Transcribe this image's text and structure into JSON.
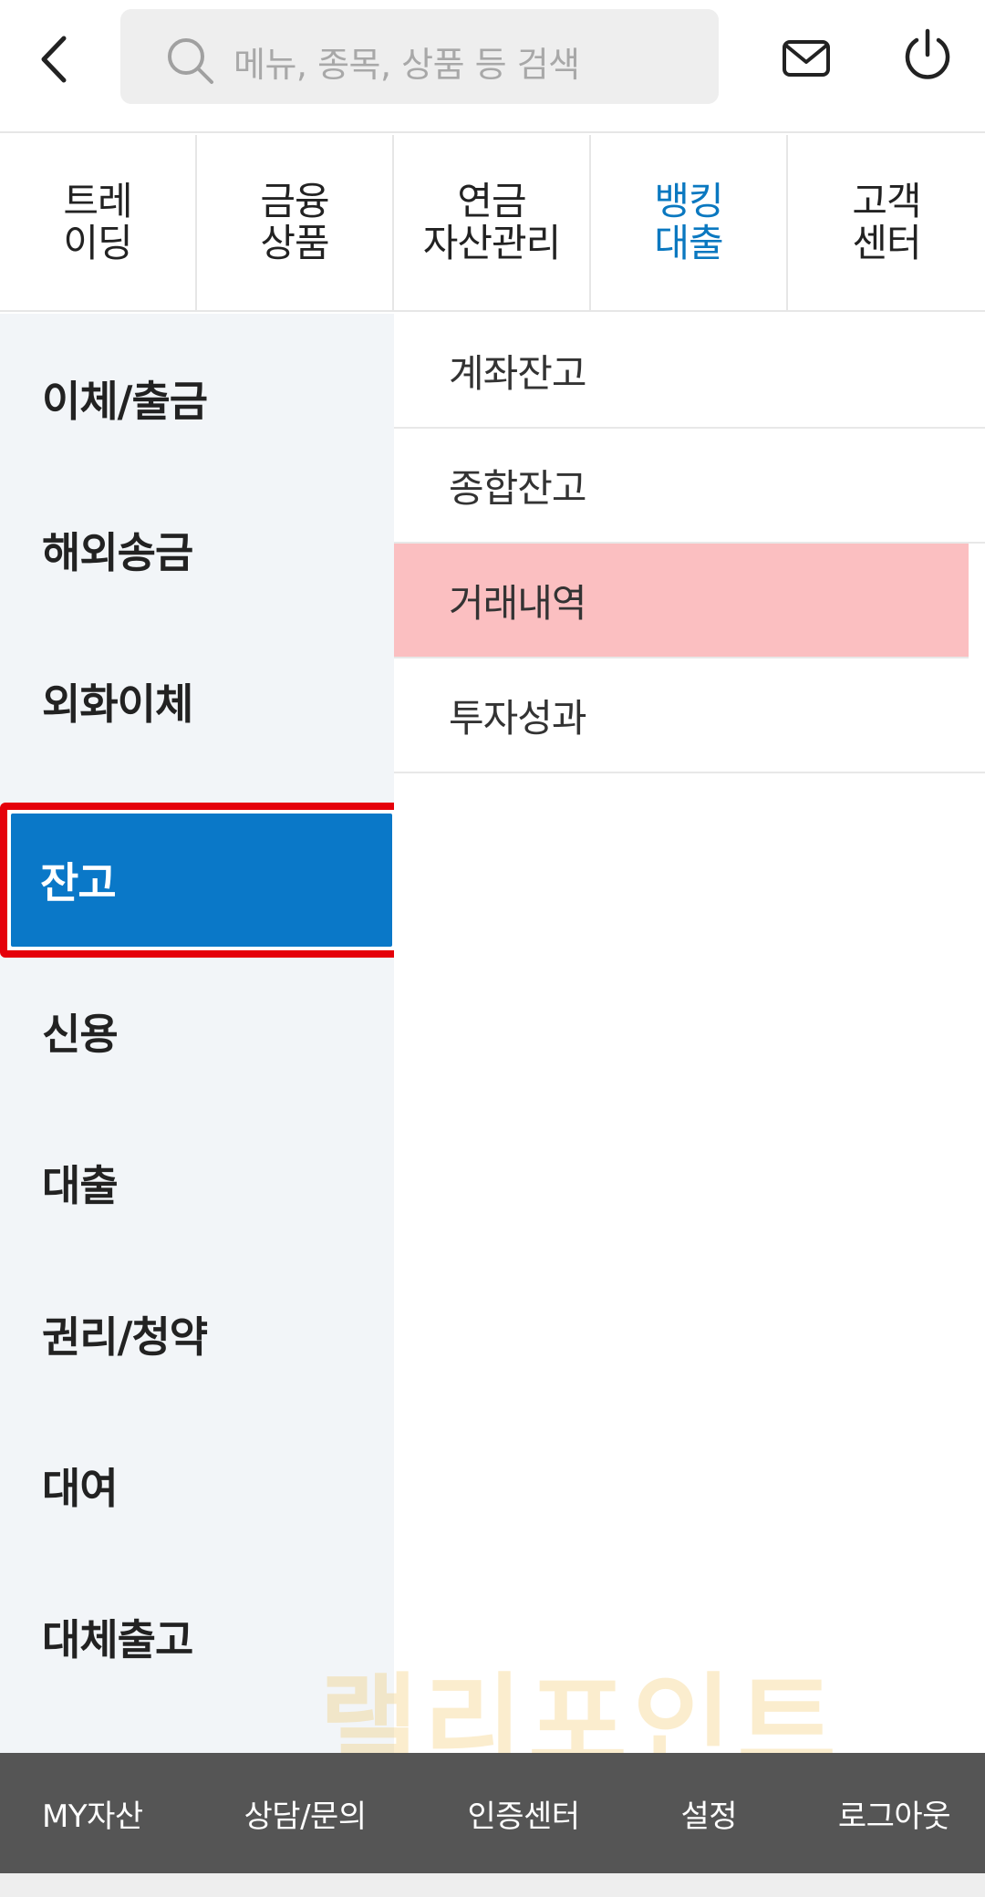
{
  "header": {
    "search_placeholder": "메뉴, 종목, 상품 등 검색",
    "icons": [
      "back-icon",
      "search-icon",
      "mail-icon",
      "power-icon"
    ]
  },
  "tabs": [
    {
      "label_line1": "트레",
      "label_line2": "이딩",
      "active": false
    },
    {
      "label_line1": "금융",
      "label_line2": "상품",
      "active": false
    },
    {
      "label_line1": "연금",
      "label_line2": "자산관리",
      "active": false
    },
    {
      "label_line1": "뱅킹",
      "label_line2": "대출",
      "active": true
    },
    {
      "label_line1": "고객",
      "label_line2": "센터",
      "active": false
    }
  ],
  "categories": [
    {
      "label": "이체/출금"
    },
    {
      "label": "해외송금"
    },
    {
      "label": "외화이체"
    },
    {
      "label": "잔고",
      "selected": true
    },
    {
      "label": "신용"
    },
    {
      "label": "대출"
    },
    {
      "label": "권리/청약"
    },
    {
      "label": "대여"
    },
    {
      "label": "대체출고"
    }
  ],
  "submenu": [
    {
      "label": "계좌잔고"
    },
    {
      "label": "종합잔고"
    },
    {
      "label": "거래내역",
      "highlighted": true
    },
    {
      "label": "투자성과"
    }
  ],
  "watermark": "랠리포인트",
  "bottom_bar": [
    "MY자산",
    "상담/문의",
    "인증센터",
    "설정",
    "로그아웃"
  ],
  "colors": {
    "accent_blue": "#0a78c8",
    "active_tab_text": "#0a78c0",
    "selection_outline": "#e5000a",
    "submenu_highlight": "#fbbfc1",
    "left_panel_bg": "#f2f5f8",
    "bottom_bar_bg": "#555555"
  }
}
